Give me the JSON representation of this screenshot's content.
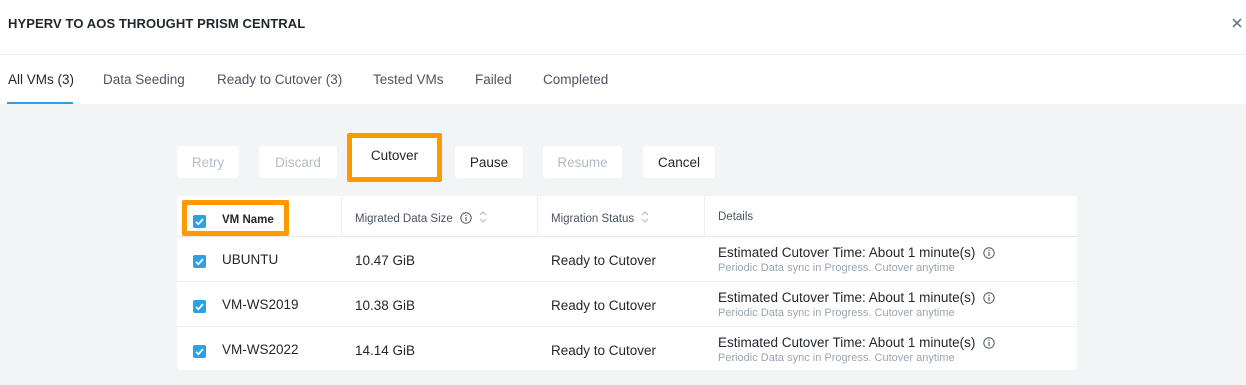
{
  "header": {
    "title": "HYPERV TO AOS THROUGHT PRISM CENTRAL",
    "close_icon": "close-icon"
  },
  "tabs": [
    {
      "label": "All VMs (3)",
      "active": true
    },
    {
      "label": "Data Seeding"
    },
    {
      "label": "Ready to Cutover (3)"
    },
    {
      "label": "Tested VMs"
    },
    {
      "label": "Failed"
    },
    {
      "label": "Completed"
    }
  ],
  "toolbar": {
    "retry": "Retry",
    "discard": "Discard",
    "cutover": "Cutover",
    "pause": "Pause",
    "resume": "Resume",
    "cancel": "Cancel"
  },
  "table": {
    "columns": {
      "vm_name": "VM Name",
      "migrated_data_size": "Migrated Data Size",
      "migration_status": "Migration Status",
      "details": "Details"
    },
    "header_checked": true,
    "rows": [
      {
        "checked": true,
        "vm_name": "UBUNTU",
        "size": "10.47 GiB",
        "status": "Ready to Cutover",
        "detail": "Estimated Cutover Time: About 1 minute(s)",
        "sub": "Periodic Data sync in Progress. Cutover anytime"
      },
      {
        "checked": true,
        "vm_name": "VM-WS2019",
        "size": "10.38 GiB",
        "status": "Ready to Cutover",
        "detail": "Estimated Cutover Time: About 1 minute(s)",
        "sub": "Periodic Data sync in Progress. Cutover anytime"
      },
      {
        "checked": true,
        "vm_name": "VM-WS2022",
        "size": "14.14 GiB",
        "status": "Ready to Cutover",
        "detail": "Estimated Cutover Time: About 1 minute(s)",
        "sub": "Periodic Data sync in Progress. Cutover anytime"
      }
    ]
  },
  "colors": {
    "accent": "#2c9fe5",
    "highlight": "#ff9900",
    "content_bg": "#f2f4f6"
  }
}
